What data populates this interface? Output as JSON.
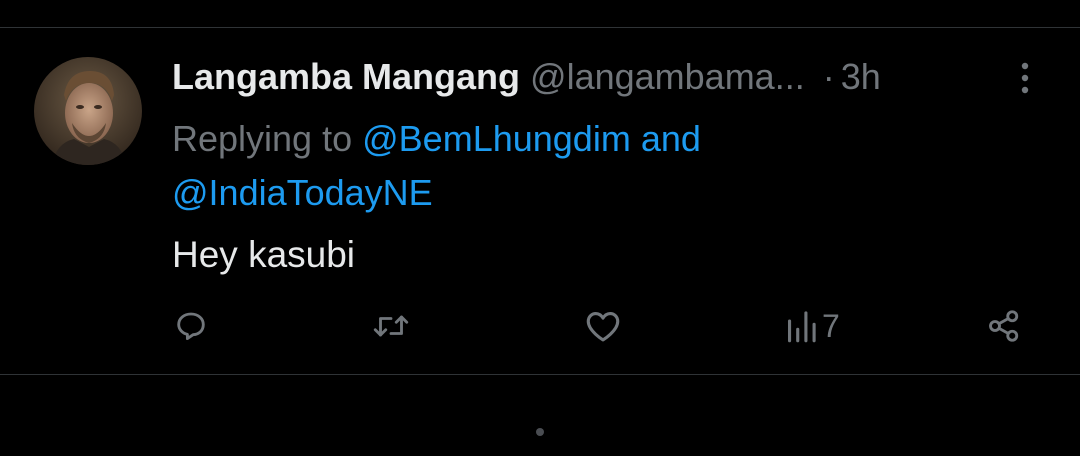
{
  "tweet": {
    "author": {
      "display_name": "Langamba Mangang",
      "handle": "@langambama...",
      "avatar_icon": "user-avatar"
    },
    "separator": "·",
    "time": "3h",
    "replying_prefix": "Replying to",
    "replying_to": [
      "@BemLhungdim",
      "@IndiaTodayNE"
    ],
    "replying_joiner": "and",
    "text": "Hey kasubi"
  },
  "actions": {
    "reply_icon": "comment-icon",
    "retweet_icon": "retweet-icon",
    "like_icon": "heart-icon",
    "views_icon": "views-icon",
    "views_count": "7",
    "share_icon": "share-icon"
  },
  "colors": {
    "background": "#000000",
    "primary_text": "#e7e9ea",
    "secondary_text": "#71767b",
    "link": "#1d9bf0",
    "divider": "#2f3336"
  }
}
